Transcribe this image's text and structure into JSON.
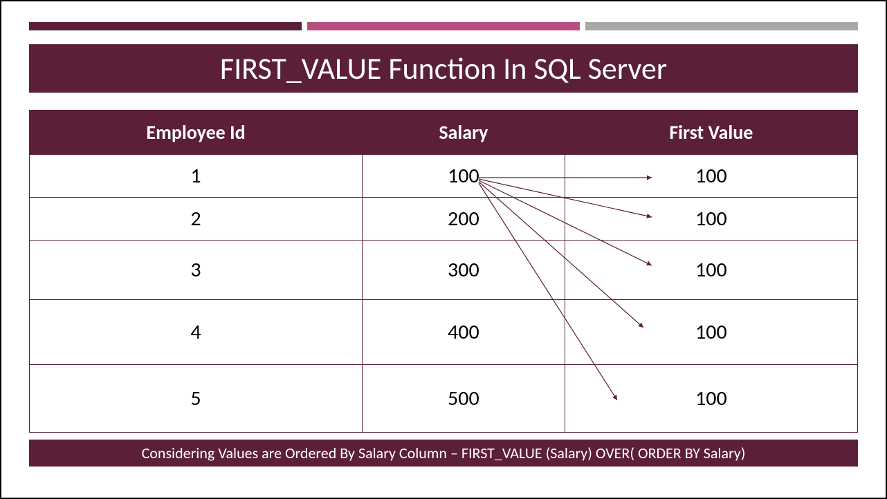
{
  "title": "FIRST_VALUE Function In SQL Server",
  "columns": {
    "c1": "Employee Id",
    "c2": "Salary",
    "c3": "First Value"
  },
  "rows": [
    {
      "id": "1",
      "salary": "100",
      "first_value": "100"
    },
    {
      "id": "2",
      "salary": "200",
      "first_value": "100"
    },
    {
      "id": "3",
      "salary": "300",
      "first_value": "100"
    },
    {
      "id": "4",
      "salary": "400",
      "first_value": "100"
    },
    {
      "id": "5",
      "salary": "500",
      "first_value": "100"
    }
  ],
  "caption": "Considering Values are Ordered By Salary Column – FIRST_VALUE (Salary) OVER( ORDER BY Salary)",
  "colors": {
    "primary": "#5C1F3A",
    "accent": "#B84D7F",
    "grey": "#A8A8A8"
  }
}
